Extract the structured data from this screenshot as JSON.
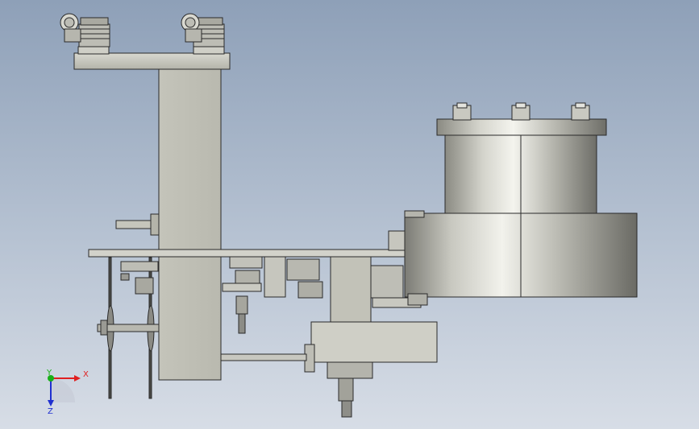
{
  "view": {
    "axis_triad": {
      "x_label": "X",
      "y_label": "Y",
      "z_label": "Z",
      "x_color": "#e02020",
      "y_color": "#18b018",
      "z_color": "#2030d0"
    },
    "colors": {
      "background_top": "#8ea0b8",
      "background_bottom": "#d7dde6",
      "metal_light": "#d9d9d2",
      "metal_mid": "#a9a9a1",
      "metal_dark": "#6e6e68",
      "plate": "#c6c6bc",
      "outline": "#2a2a2a"
    }
  }
}
